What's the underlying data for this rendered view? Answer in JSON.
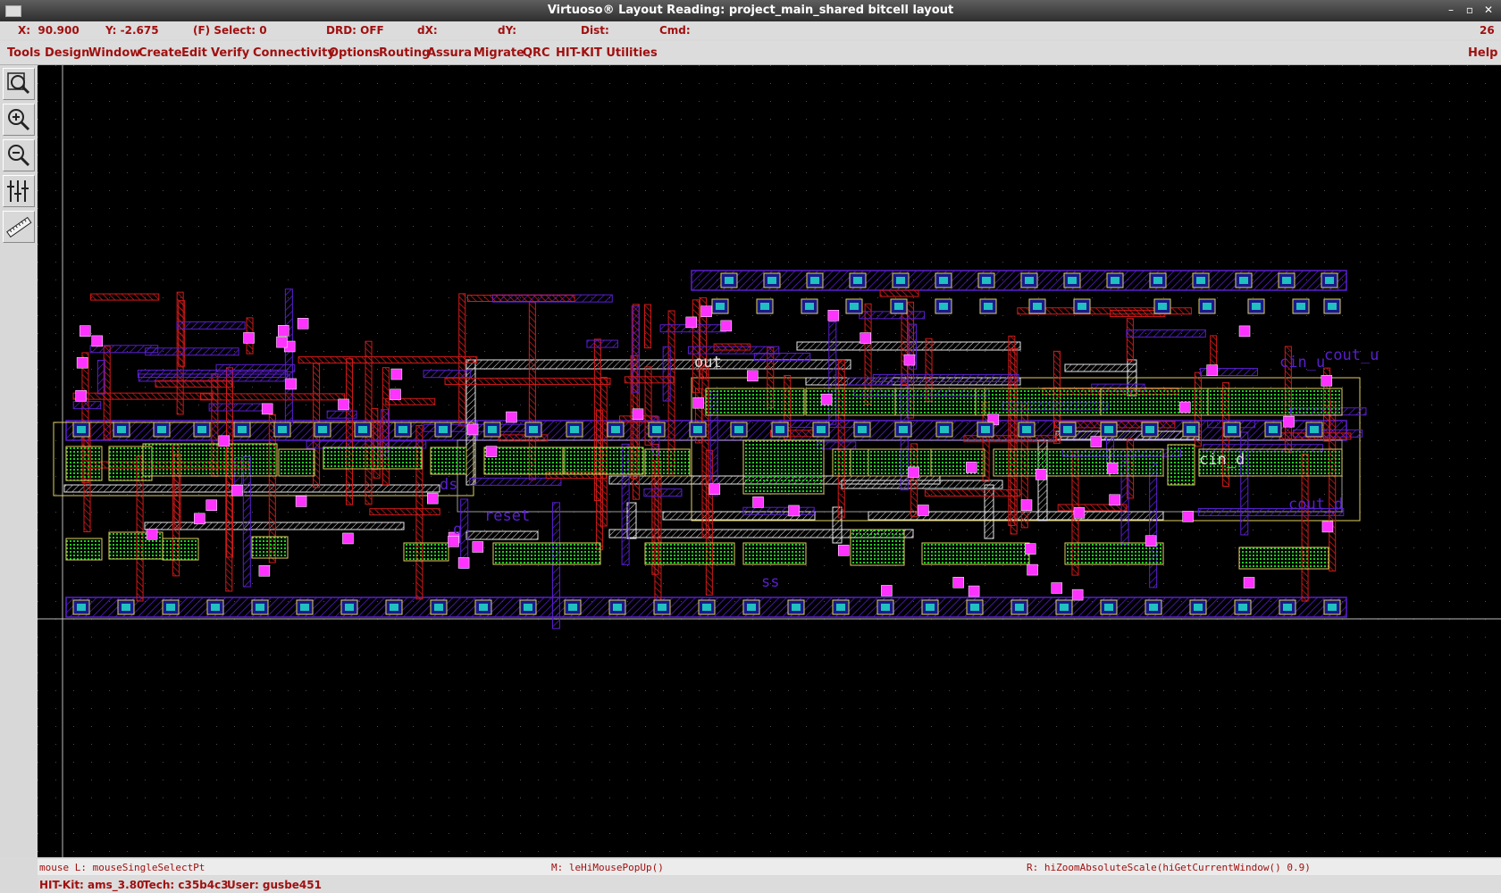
{
  "window": {
    "title": "Virtuoso® Layout Reading: project_main_shared bitcell layout"
  },
  "status": {
    "x": "X:  90.900",
    "y": "Y: -2.675",
    "select": "(F) Select: 0",
    "drd": "DRD: OFF",
    "dx": "dX:",
    "dy": "dY:",
    "dist": "Dist:",
    "cmd": "Cmd:",
    "count": "26"
  },
  "menu": {
    "items": [
      "Tools",
      "Design",
      "Window",
      "Create",
      "Edit",
      "Verify",
      "Connectivity",
      "Options",
      "Routing",
      "Assura",
      "Migrate",
      "QRC",
      "HIT-KIT Utilities"
    ],
    "help": "Help"
  },
  "tools": [
    "zoom-fit-icon",
    "zoom-in-icon",
    "zoom-out-icon",
    "stretch-icon",
    "ruler-icon"
  ],
  "layout": {
    "labels": [
      "out",
      "cin_u",
      "cout_u",
      "cin_d",
      "cout_d",
      "ds",
      "q",
      "reset",
      "ss"
    ]
  },
  "mouse": {
    "left": "mouse L: mouseSingleSelectPt",
    "middle": "M: leHiMousePopUp()",
    "right": "R: hiZoomAbsoluteScale(hiGetCurrentWindow() 0.9)"
  },
  "info": {
    "kit": "HIT-Kit: ams_3.80",
    "tech": "Tech: c35b4c3",
    "user": "User: gusbe451"
  },
  "colors": {
    "metal1": "#5a1fd0",
    "metal2": "#d21a1a",
    "poly": "#ffffff",
    "contact": "#ff33ff",
    "diffusion": "#1bd01b",
    "nwell": "#e0d060",
    "canvas": "#000000",
    "menu_text": "#a01010"
  }
}
